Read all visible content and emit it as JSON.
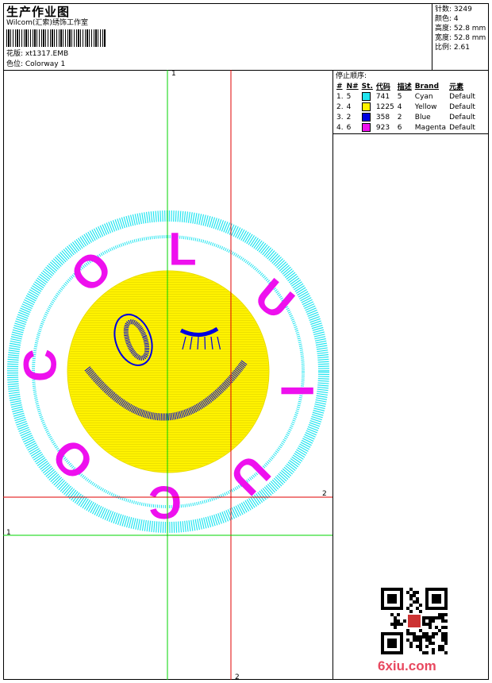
{
  "header": {
    "title": "生产作业图",
    "subtitle": "Wilcom(汇索)绣饰工作室",
    "design_label": "花版: xt1317.EMB",
    "colorway_label": "色位: Colorway 1"
  },
  "stats": [
    {
      "label": "针数",
      "value": "3249"
    },
    {
      "label": "颜色",
      "value": "4"
    },
    {
      "label": "高度",
      "value": "52.8 mm"
    },
    {
      "label": "宽度",
      "value": "52.8 mm"
    },
    {
      "label": "比例",
      "value": "2.61"
    }
  ],
  "color_table": {
    "title": "停止顺序:",
    "headers": [
      "#",
      "N#",
      "St.",
      "代码",
      "描述",
      "Brand",
      "元素"
    ],
    "rows": [
      {
        "num": "1.",
        "n": "5",
        "color": "#22e5f0",
        "st": "741",
        "code": "5",
        "desc": "Cyan",
        "brand": "Default"
      },
      {
        "num": "2.",
        "n": "4",
        "color": "#fff200",
        "st": "1225",
        "code": "4",
        "desc": "Yellow",
        "brand": "Default"
      },
      {
        "num": "3.",
        "n": "2",
        "color": "#0000e0",
        "st": "358",
        "code": "2",
        "desc": "Blue",
        "brand": "Default"
      },
      {
        "num": "4.",
        "n": "6",
        "color": "#ee10ee",
        "st": "923",
        "code": "6",
        "desc": "Magenta",
        "brand": "Default"
      }
    ]
  },
  "guides": {
    "v1": "1",
    "v2": "2",
    "h1": "1",
    "h2": "2"
  },
  "design_letters": [
    "C",
    "O",
    "O",
    "L",
    "U",
    "I",
    "L",
    "U",
    "C",
    "O"
  ],
  "watermark": "6xiu.com",
  "colors": {
    "cyan": "#22e5f0",
    "yellow": "#fff200",
    "blue": "#0000e0",
    "magenta": "#ee10ee",
    "green": "#00d400",
    "red": "#e00000"
  }
}
